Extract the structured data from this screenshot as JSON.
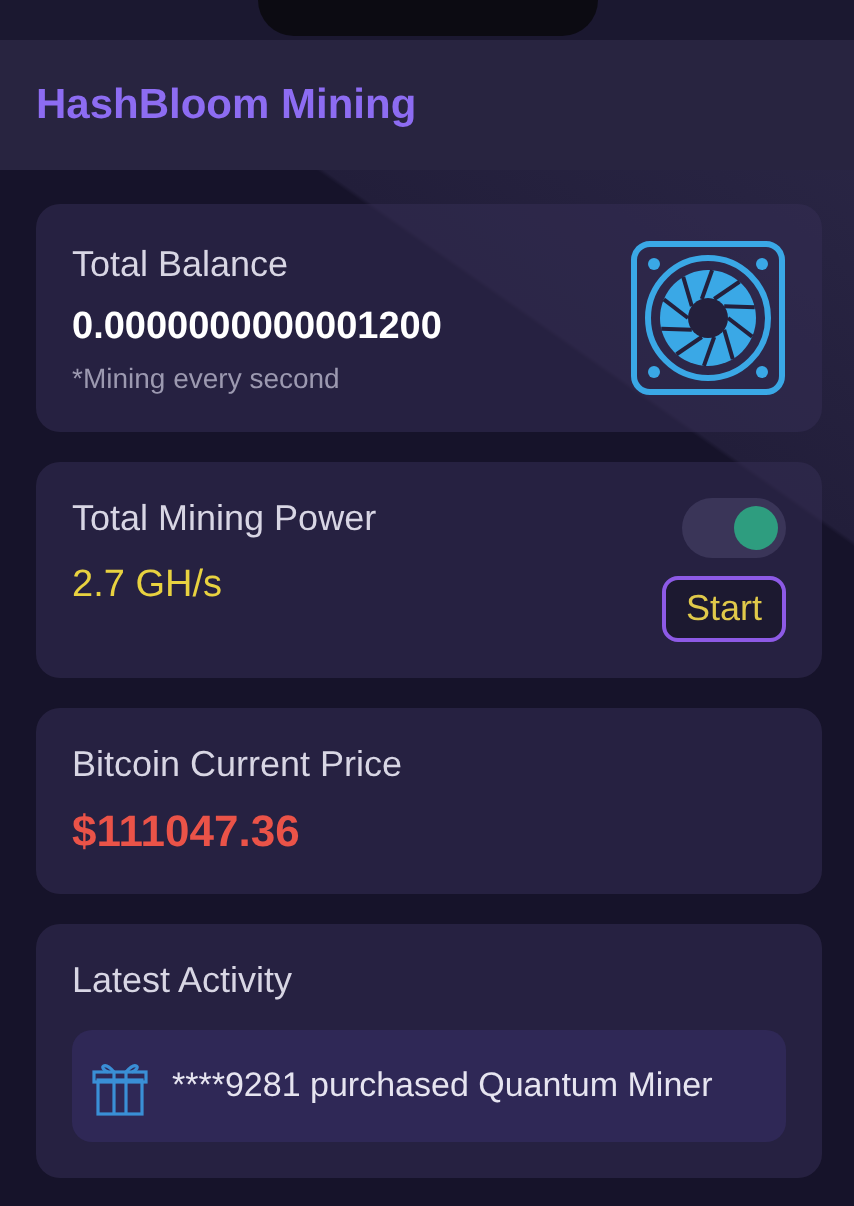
{
  "app_title": "HashBloom Mining",
  "balance": {
    "label": "Total Balance",
    "value": "0.0000000000001200",
    "note": "*Mining every second"
  },
  "power": {
    "label": "Total Mining Power",
    "value": "2.7 GH/s",
    "toggle": {
      "on": true
    },
    "button": "Start"
  },
  "price": {
    "label": "Bitcoin Current Price",
    "value": "$111047.36"
  },
  "activity": {
    "title": "Latest Activity",
    "items": [
      {
        "text": "****9281 purchased Quantum Miner"
      }
    ]
  }
}
